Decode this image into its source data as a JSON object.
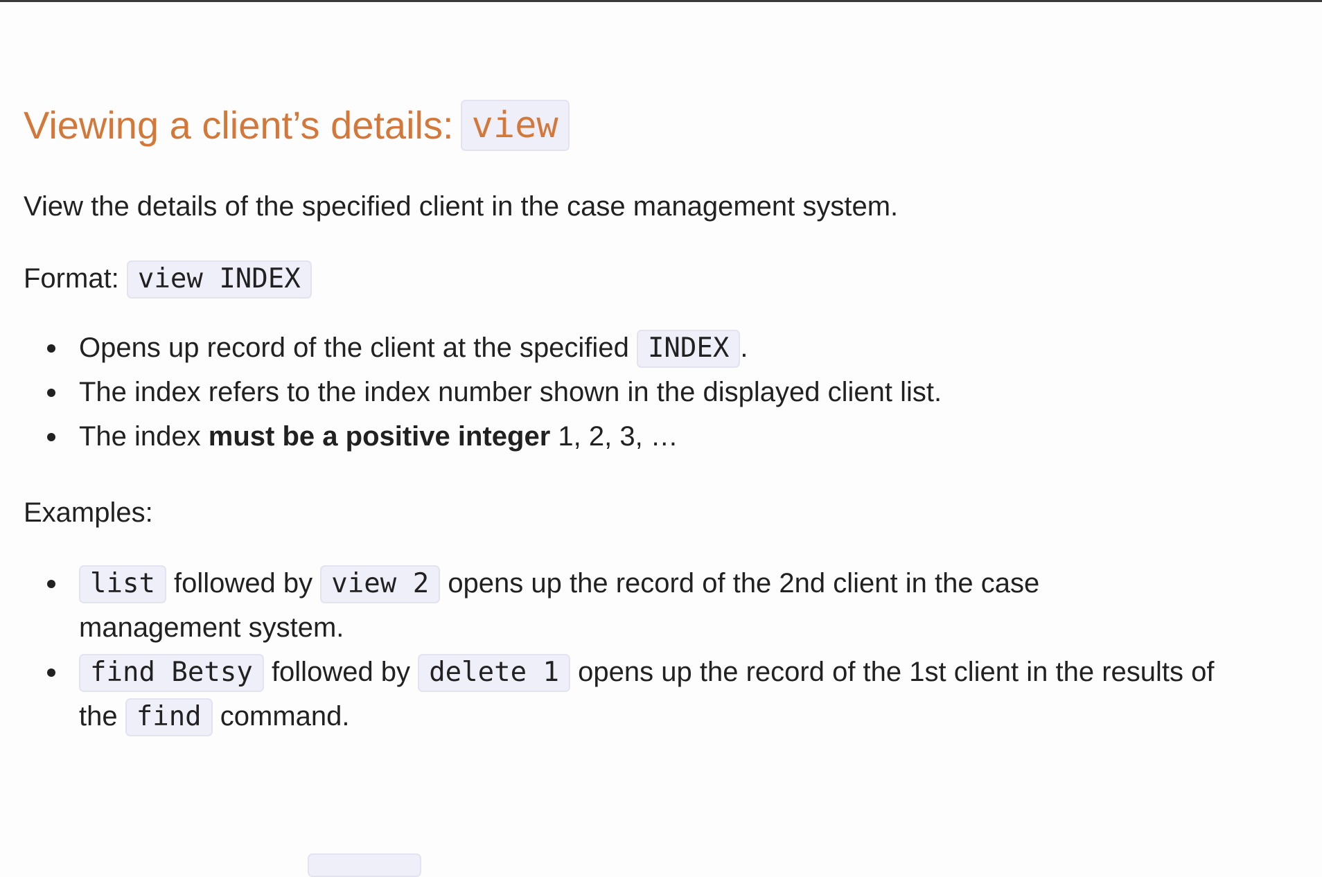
{
  "heading": {
    "text": "Viewing a client’s details:",
    "command": "view"
  },
  "description": "View the details of the specified client in the case management system.",
  "format": {
    "label": "Format:",
    "command": "view INDEX"
  },
  "notes": {
    "item1": {
      "text": "Opens up record of the client at the specified",
      "code": "INDEX",
      "suffix": "."
    },
    "item2": {
      "text": "The index refers to the index number shown in the displayed client list."
    },
    "item3": {
      "prefix": "The index",
      "bold": "must be a positive integer",
      "suffix": "1, 2, 3, …"
    }
  },
  "examples": {
    "label": "Examples:",
    "ex1": {
      "code1": "list",
      "text1": "followed by",
      "code2": "view 2",
      "text2": "opens up the record of the 2nd client in the case",
      "text3": "management system."
    },
    "ex2": {
      "code1": "find Betsy",
      "text1": "followed by",
      "code2": "delete 1",
      "text2": "opens up the record of the 1st client in the results of",
      "text3": "the",
      "code3": "find",
      "text4": "command."
    }
  }
}
